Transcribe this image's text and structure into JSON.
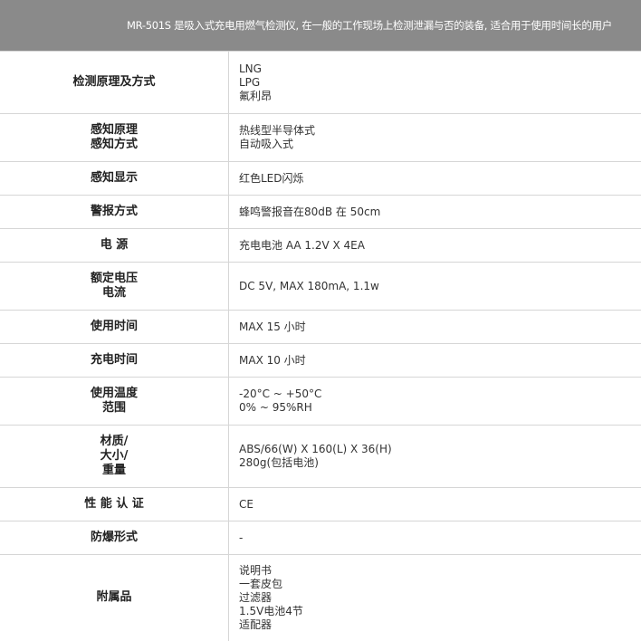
{
  "banner": {
    "text": "MR-501S 是吸入式充电用燃气检测仪, 在一般的工作现场上检测泄漏与否的装备, 适合用于使用时间长的用户"
  },
  "rows": [
    {
      "label": "检测原理及方式",
      "value": "LNG\nLPG\n氟利昂"
    },
    {
      "label": "感知原理\n感知方式",
      "value": "热线型半导体式\n自动吸入式"
    },
    {
      "label": "感知显示",
      "value": "红色LED闪烁"
    },
    {
      "label": "警报方式",
      "value": "蜂鸣警报音在80dB 在 50cm"
    },
    {
      "label": "电  源",
      "value": "充电电池 AA 1.2V X 4EA"
    },
    {
      "label": "额定电压\n电流",
      "value": "DC 5V, MAX 180mA, 1.1w"
    },
    {
      "label": "使用时间",
      "value": "MAX 15 小时"
    },
    {
      "label": "充电时间",
      "value": "MAX 10 小时"
    },
    {
      "label": "使用温度\n范围",
      "value": "-20°C ~ +50°C\n0% ~ 95%RH"
    },
    {
      "label": "材质/\n大小/\n重量",
      "value": "ABS/66(W) X 160(L) X 36(H)\n280g(包括电池)"
    },
    {
      "label": "性 能 认 证",
      "value": "CE"
    },
    {
      "label": "防爆形式",
      "value": "-"
    },
    {
      "label": "附属品",
      "value": "说明书\n一套皮包\n过滤器\n1.5V电池4节\n适配器"
    }
  ]
}
